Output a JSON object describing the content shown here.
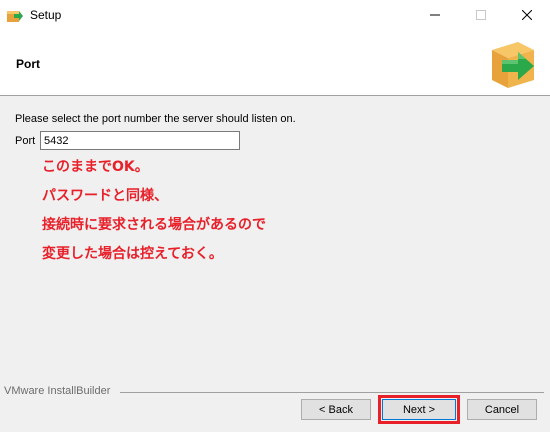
{
  "window": {
    "title": "Setup",
    "icon": "installer-box-icon"
  },
  "header": {
    "title": "Port",
    "logo": "box-arrow-logo-icon"
  },
  "main": {
    "instruction": "Please select the port number the server should listen on.",
    "port_label": "Port",
    "port_value": "5432"
  },
  "annotation": {
    "color": "#e8202a",
    "lines": [
      "このままでOK。",
      "パスワードと同様、",
      "接続時に要求される場合があるので",
      "変更した場合は控えておく。"
    ]
  },
  "footer": {
    "brand": "VMware InstallBuilder",
    "back_label": "< Back",
    "next_label": "Next >",
    "cancel_label": "Cancel"
  }
}
